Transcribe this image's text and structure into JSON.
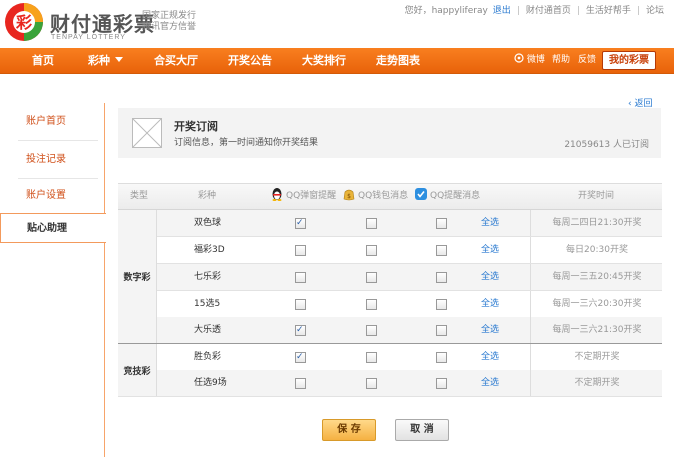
{
  "header": {
    "logo_text": "财付通彩票",
    "logo_sub": "TENPAY LOTTERY",
    "tagline_line1": "国家正规发行",
    "tagline_line2": "腾讯官方信誉",
    "greeting": "您好，happyliferay",
    "logout": "退出",
    "home_link": "财付通首页",
    "helper_link": "生活好帮手",
    "forum_link": "论坛"
  },
  "nav": {
    "items": [
      "首页",
      "彩种",
      "合买大厅",
      "开奖公告",
      "大奖排行",
      "走势图表"
    ],
    "weibo": "微博",
    "help": "帮助",
    "feedback": "反馈",
    "my_lottery": "我的彩票"
  },
  "sidebar": {
    "items": [
      "账户首页",
      "投注记录",
      "账户设置",
      "贴心助理"
    ]
  },
  "main": {
    "back": "返回",
    "sub_title": "开奖订阅",
    "sub_desc": "订阅信息，第一时间通知你开奖结果",
    "sub_count": "21059613 人已订阅"
  },
  "table": {
    "headers": [
      "类型",
      "彩种",
      "QQ弹窗提醒",
      "QQ钱包消息",
      "QQ提醒消息",
      "开奖时间"
    ],
    "select_all": "全选",
    "groups": [
      "数字彩",
      "竞技彩"
    ],
    "rows": [
      {
        "name": "双色球",
        "c": [
          true,
          false,
          false
        ],
        "time": "每周二四日21:30开奖"
      },
      {
        "name": "福彩3D",
        "c": [
          false,
          false,
          false
        ],
        "time": "每日20:30开奖"
      },
      {
        "name": "七乐彩",
        "c": [
          false,
          false,
          false
        ],
        "time": "每周一三五20:45开奖"
      },
      {
        "name": "15选5",
        "c": [
          false,
          false,
          false
        ],
        "time": "每周一三六20:30开奖"
      },
      {
        "name": "大乐透",
        "c": [
          true,
          false,
          false
        ],
        "time": "每周一三六21:30开奖"
      },
      {
        "name": "胜负彩",
        "c": [
          true,
          false,
          false
        ],
        "time": "不定期开奖"
      },
      {
        "name": "任选9场",
        "c": [
          false,
          false,
          false
        ],
        "time": "不定期开奖"
      }
    ]
  },
  "buttons": {
    "save": "保 存",
    "cancel": "取 消"
  },
  "colors": {
    "nav_orange": "#f0701a",
    "link_blue": "#2a7ad0",
    "sidebar_text": "#d0501a"
  }
}
